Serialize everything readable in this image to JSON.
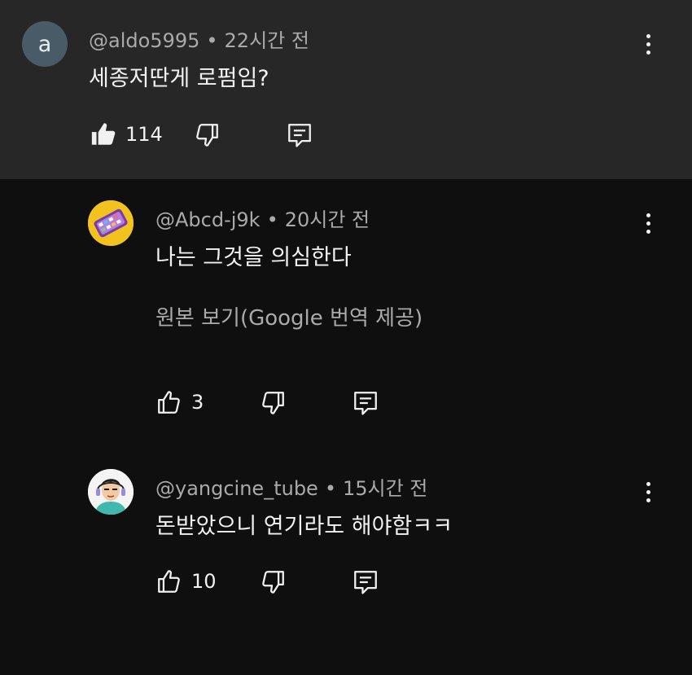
{
  "comments": [
    {
      "avatar_letter": "a",
      "handle": "@aldo5995",
      "time": "22시간 전",
      "text": "세종저딴게 로펌임?",
      "likes": "114",
      "liked": true
    },
    {
      "handle": "@Abcd-j9k",
      "time": "20시간 전",
      "text": "나는 그것을 의심한다",
      "translate_label": "원본 보기(Google 번역 제공)",
      "likes": "3",
      "liked": false
    },
    {
      "handle": "@yangcine_tube",
      "time": "15시간 전",
      "text": "돈받았으니 연기라도 해야함ㅋㅋ",
      "likes": "10",
      "liked": false
    }
  ],
  "separator": "•",
  "icons": {
    "like": "thumbs-up-icon",
    "dislike": "thumbs-down-icon",
    "reply": "reply-icon",
    "more": "more-vert-icon"
  },
  "colors": {
    "background": "#0f0f0f",
    "highlight_background": "#272727",
    "primary_text": "#f1f1f1",
    "secondary_text": "#aaaaaa"
  }
}
